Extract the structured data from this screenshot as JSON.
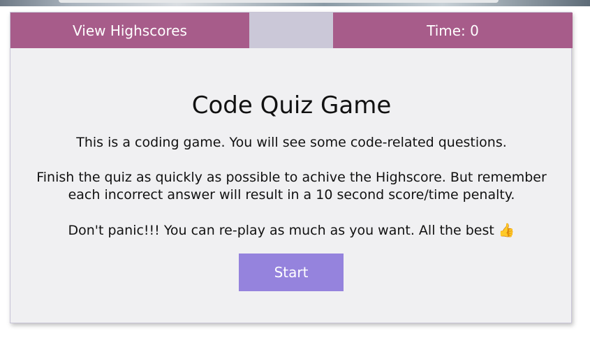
{
  "header": {
    "highscores_label": "View Highscores",
    "timer_label": "Time: 0"
  },
  "intro": {
    "title": "Code Quiz Game",
    "line1": "This is a coding game. You will see some code-related questions.",
    "line2": "Finish the quiz as quickly as possible to achive the Highscore. But remember each incorrect answer will result in a 10 second score/time penalty.",
    "line3": "Don't panic!!! You can re-play as much as you want. All the best 👍",
    "start_label": "Start"
  },
  "colors": {
    "header_bg": "#a75c8a",
    "header_gap": "#cbc8d8",
    "card_bg": "#f0f0f2",
    "start_bg": "#9583dd"
  }
}
